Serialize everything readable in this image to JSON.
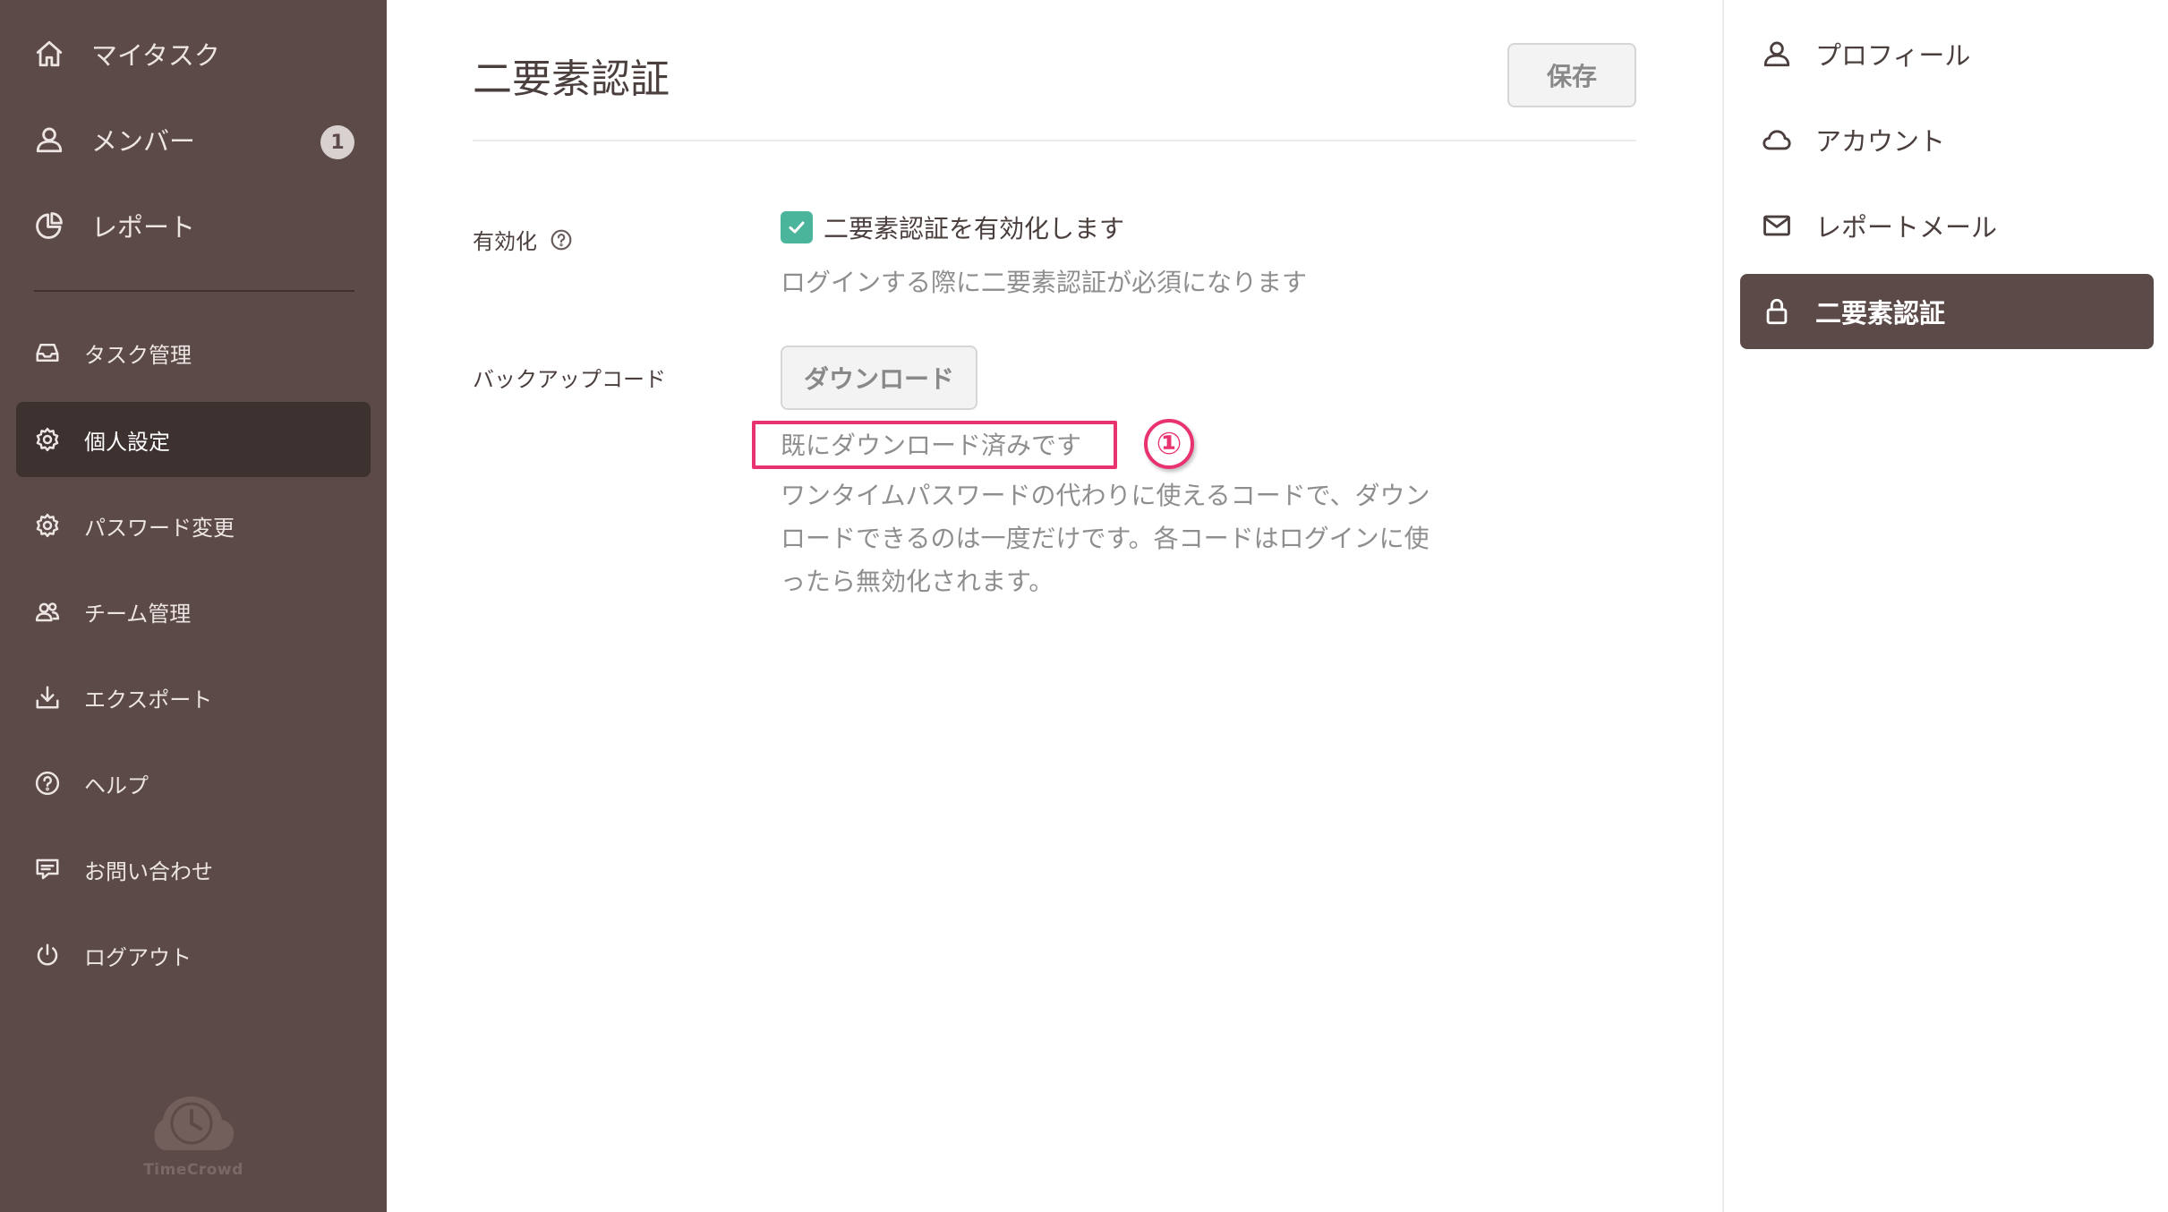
{
  "sidebar": {
    "items": [
      {
        "label": "マイタスク",
        "icon": "home-icon"
      },
      {
        "label": "メンバー",
        "icon": "person-icon",
        "badge": "1"
      },
      {
        "label": "レポート",
        "icon": "pie-chart-icon"
      },
      {
        "label": "タスク管理",
        "icon": "inbox-icon"
      },
      {
        "label": "個人設定",
        "icon": "gear-icon",
        "active": true
      },
      {
        "label": "パスワード変更",
        "icon": "gear-icon"
      },
      {
        "label": "チーム管理",
        "icon": "team-icon"
      },
      {
        "label": "エクスポート",
        "icon": "download-icon"
      },
      {
        "label": "ヘルプ",
        "icon": "help-icon"
      },
      {
        "label": "お問い合わせ",
        "icon": "chat-icon"
      },
      {
        "label": "ログアウト",
        "icon": "power-icon"
      }
    ],
    "logo_text": "TimeCrowd"
  },
  "main": {
    "title": "二要素認証",
    "save_label": "保存",
    "enable": {
      "label": "有効化",
      "checkbox_label": "二要素認証を有効化します",
      "checked": true,
      "hint": "ログインする際に二要素認証が必須になります"
    },
    "backup": {
      "label": "バックアップコード",
      "download_label": "ダウンロード",
      "status": "既にダウンロード済みです",
      "step_marker": "①",
      "description": "ワンタイムパスワードの代わりに使えるコードで、ダウンロードできるのは一度だけです。各コードはログインに使ったら無効化されます。"
    }
  },
  "right_panel": {
    "items": [
      {
        "label": "プロフィール",
        "icon": "person-icon"
      },
      {
        "label": "アカウント",
        "icon": "cloud-icon"
      },
      {
        "label": "レポートメール",
        "icon": "mail-icon"
      },
      {
        "label": "二要素認証",
        "icon": "lock-icon",
        "active": true
      }
    ]
  },
  "colors": {
    "sidebar_bg": "#5b4a48",
    "sidebar_active": "#3e3230",
    "check_green": "#4bb59c",
    "highlight_pink": "#e8336e"
  }
}
